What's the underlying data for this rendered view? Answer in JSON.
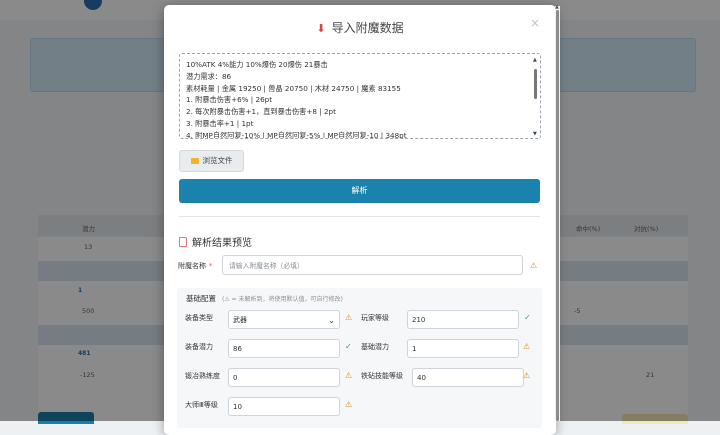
{
  "background": {
    "table": {
      "headers": [
        "潜力",
        "命中(%)",
        "对抗(%)"
      ],
      "cells": [
        "13",
        "500",
        "-5",
        "-125",
        "21"
      ],
      "row_labels": [
        "1",
        "481"
      ]
    }
  },
  "modal": {
    "title": "导入附魔数据",
    "close": "×",
    "textarea_lines": [
      "10%ATK 4%能力 10%爆伤 20爆伤 21暴击",
      "潜力需求：86",
      "素材耗量 | 金属 19250 | 兽晶 20750 | 木材 24750 | 魔素 83155",
      "1. 附暴击伤害+6% | 26pt",
      "2. 每次附暴击伤害+1，直到暴击伤害+8 | 2pt",
      "3. 附暴击率+1 | 1pt",
      "4. 附MP自然回复-10% | MP自然回复-5% | MP自然回复-10 | 348pt"
    ],
    "browse_label": "浏览文件",
    "parse_label": "解析",
    "preview_title": "解析结果预览",
    "name_field": {
      "label": "附魔名称",
      "required": "*",
      "placeholder": "请输入附魔名称（必填）"
    },
    "basic": {
      "title": "基础配置",
      "hint": "(⚠ = 未解析到，将使用默认值，可自行修改)",
      "fields": {
        "equip_type": {
          "label": "装备类型",
          "value": "武器"
        },
        "player_level": {
          "label": "玩家等级",
          "value": "210"
        },
        "equip_potential": {
          "label": "装备潜力",
          "value": "86"
        },
        "base_potential": {
          "label": "基础潜力",
          "value": "1"
        },
        "smith_proficiency": {
          "label": "锻冶熟练度",
          "value": "0"
        },
        "iron_skill_level": {
          "label": "铁砧技能等级",
          "value": "40"
        },
        "master_level": {
          "label": "大师Ⅲ等级",
          "value": "10"
        }
      }
    },
    "icons": {
      "warn": "⚠",
      "ok": "✓",
      "chevron": "⌄"
    }
  }
}
